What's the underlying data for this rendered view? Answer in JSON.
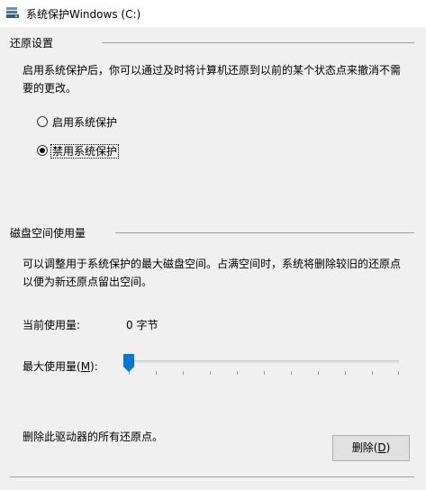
{
  "window": {
    "title": "系统保护Windows (C:)"
  },
  "restore": {
    "heading": "还原设置",
    "description_line1": "启用系统保护后，你可以通过及时将计算机还原到以前的某个状态点来撤消不需",
    "description_line2": "要的更改。",
    "options": [
      {
        "label": "启用系统保护",
        "selected": false
      },
      {
        "label": "禁用系统保护",
        "selected": true
      }
    ]
  },
  "disk": {
    "heading": "磁盘空间使用量",
    "description_line1": "可以调整用于系统保护的最大磁盘空间。占满空间时，系统将删除较旧的还原点",
    "description_line2": "以便为新还原点留出空间。",
    "current_usage_label": "当前使用量:",
    "current_usage_value": "0 字节",
    "max_usage_label_prefix": "最大使用量(",
    "max_usage_hotkey": "M",
    "max_usage_label_suffix": "):",
    "max_usage_percent": 0
  },
  "delete": {
    "text": "删除此驱动器的所有还原点。",
    "button_prefix": "删除(",
    "button_hotkey": "D",
    "button_suffix": ")"
  },
  "colors": {
    "thumb": "#0078d7",
    "background": "#f0f0f0"
  }
}
